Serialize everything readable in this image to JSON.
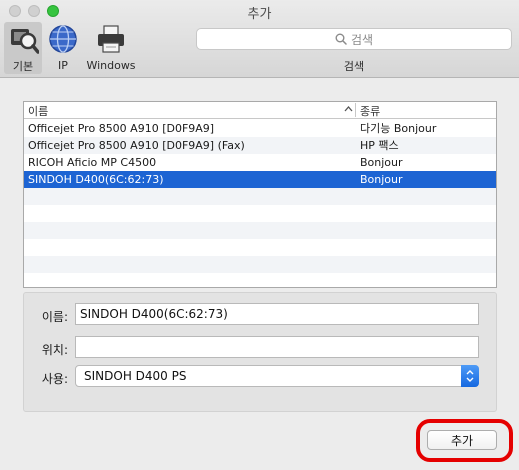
{
  "window": {
    "title": "추가"
  },
  "toolbar": {
    "buttons": [
      {
        "label": "기본",
        "icon": "default-printer-magnifier-icon"
      },
      {
        "label": "IP",
        "icon": "globe-icon"
      },
      {
        "label": "Windows",
        "icon": "printer-icon"
      }
    ],
    "search": {
      "placeholder": "검색",
      "caption": "검색"
    }
  },
  "list": {
    "columns": {
      "name": "이름",
      "kind": "종류"
    },
    "rows": [
      {
        "name": "Officejet Pro 8500 A910 [D0F9A9]",
        "kind": "다기능 Bonjour"
      },
      {
        "name": "Officejet Pro 8500 A910 [D0F9A9] (Fax)",
        "kind": "HP 팩스"
      },
      {
        "name": "RICOH Aficio MP C4500",
        "kind": "Bonjour"
      },
      {
        "name": "SINDOH D400(6C:62:73)",
        "kind": "Bonjour"
      }
    ]
  },
  "form": {
    "name_label": "이름:",
    "name_value": "SINDOH D400(6C:62:73)",
    "location_label": "위치:",
    "location_value": "",
    "use_label": "사용:",
    "use_value": "SINDOH D400 PS"
  },
  "add_button": {
    "label": "추가"
  },
  "colors": {
    "selection": "#1d64d3",
    "highlight": "#e50000",
    "accent": "#1568e0"
  }
}
